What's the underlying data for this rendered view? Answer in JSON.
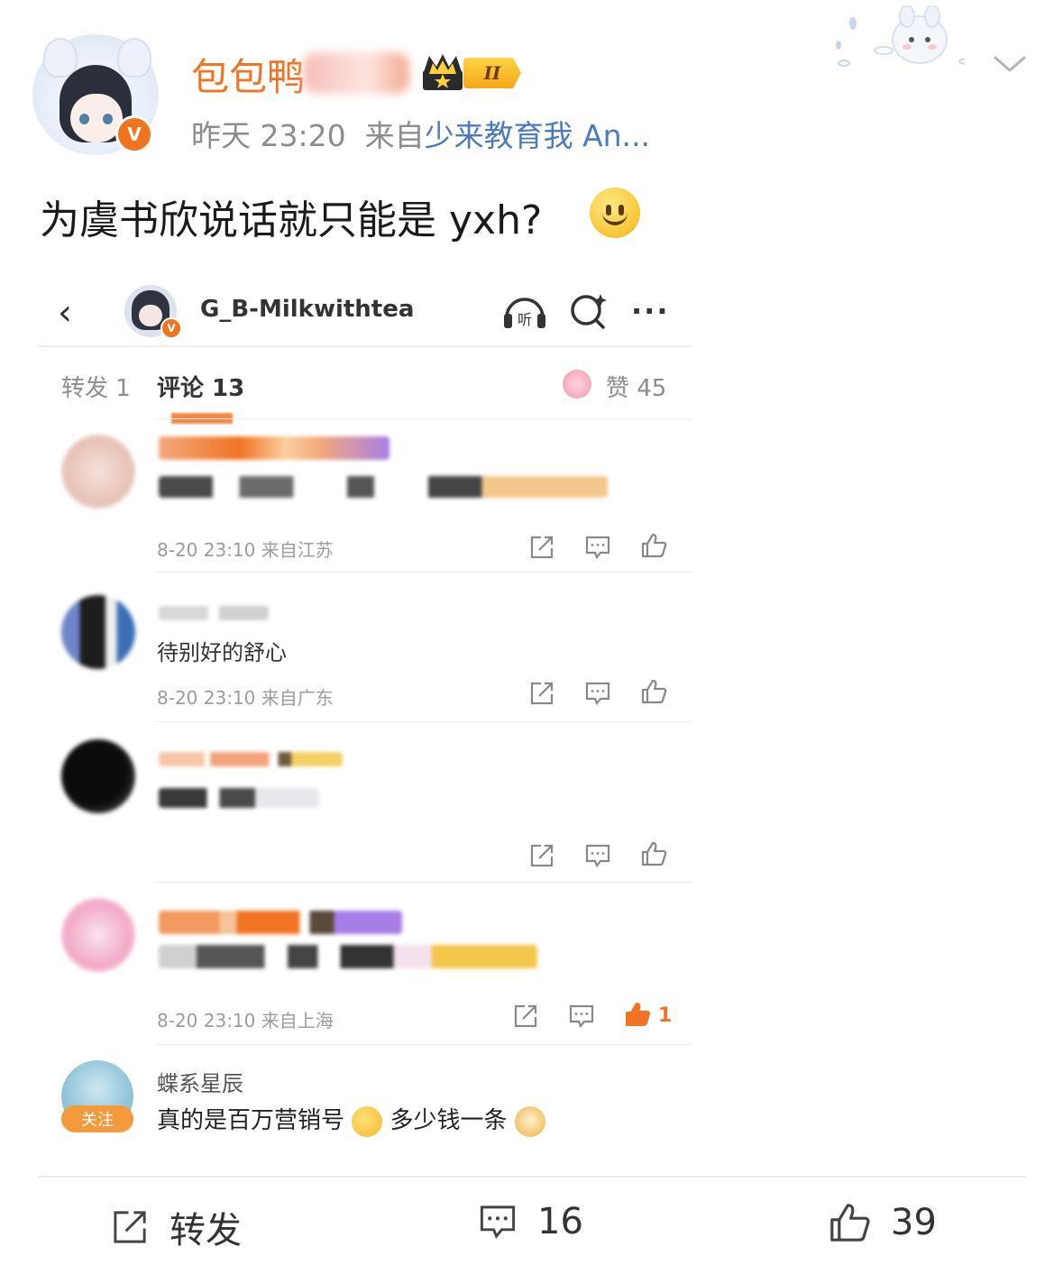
{
  "post": {
    "username": "包包鸭",
    "level_badge": "II",
    "time": "昨天 23:20",
    "from_label": "来自",
    "source": "少来教育我 An...",
    "text": "为虞书欣说话就只能是 yxh?",
    "verified_mark": "V"
  },
  "screenshot": {
    "back_glyph": "‹",
    "account_name": "G_B-Milkwithtea",
    "listen_label": "听",
    "more_glyph": "···",
    "tabs": {
      "repost": "转发 1",
      "comment": "评论 13",
      "like": "赞 45"
    },
    "comments": [
      {
        "text": "",
        "meta": "8-20 23:10 来自江苏",
        "like_count": ""
      },
      {
        "text": "待别好的舒心",
        "meta": "8-20 23:10 来自广东",
        "like_count": ""
      },
      {
        "text": "",
        "meta": "",
        "like_count": ""
      },
      {
        "text": "",
        "meta": "8-20 23:10 来自上海",
        "like_count": "1"
      },
      {
        "name": "蝶系星辰",
        "follow_label": "关注",
        "text_a": "真的是百万营销号",
        "text_b": "多少钱一条"
      }
    ]
  },
  "footer": {
    "repost_label": "转发",
    "comment_count": "16",
    "like_count": "39"
  },
  "colors": {
    "brand_orange": "#f07424",
    "link_blue": "#4b7bbd",
    "meta_gray": "#8c8c8c"
  },
  "icons": [
    "crown-icon",
    "chevron-down-icon",
    "back-icon",
    "headphones-icon",
    "search-icon",
    "more-icon",
    "share-icon",
    "comment-icon",
    "like-icon"
  ]
}
